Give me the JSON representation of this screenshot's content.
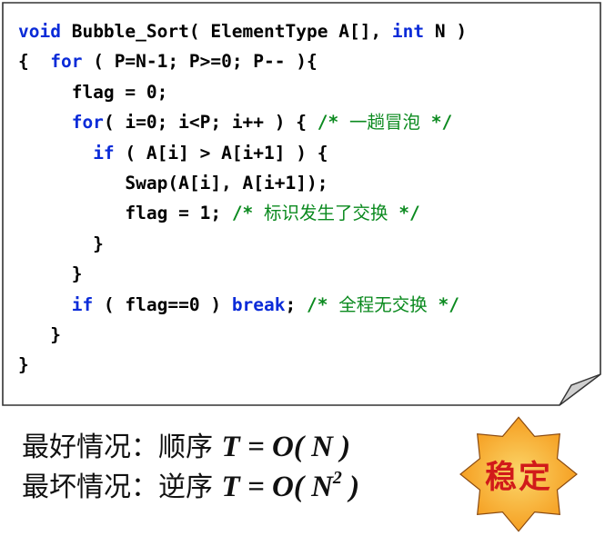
{
  "code": {
    "lines": [
      [
        {
          "t": "void",
          "c": "kw"
        },
        {
          "t": " Bubble_Sort( ElementType A[], ",
          "c": ""
        },
        {
          "t": "int",
          "c": "kw"
        },
        {
          "t": " N )",
          "c": ""
        }
      ],
      [
        {
          "t": "{  ",
          "c": ""
        },
        {
          "t": "for",
          "c": "kw"
        },
        {
          "t": " ( P=N-1; P>=0; P-- ){",
          "c": ""
        }
      ],
      [
        {
          "t": "     flag = 0;",
          "c": ""
        }
      ],
      [
        {
          "t": "     ",
          "c": ""
        },
        {
          "t": "for",
          "c": "kw"
        },
        {
          "t": "( i=0; i<P; i++ ) { ",
          "c": ""
        },
        {
          "t": "/* ",
          "c": "cm"
        },
        {
          "t": "一趟冒泡",
          "c": "cm cm-text"
        },
        {
          "t": " */",
          "c": "cm"
        }
      ],
      [
        {
          "t": "       ",
          "c": ""
        },
        {
          "t": "if",
          "c": "kw"
        },
        {
          "t": " ( A[i] > A[i+1] ) {",
          "c": ""
        }
      ],
      [
        {
          "t": "          Swap(A[i], A[i+1]);",
          "c": ""
        }
      ],
      [
        {
          "t": "          flag = 1; ",
          "c": ""
        },
        {
          "t": "/* ",
          "c": "cm"
        },
        {
          "t": "标识发生了交换",
          "c": "cm cm-text"
        },
        {
          "t": " */",
          "c": "cm"
        }
      ],
      [
        {
          "t": "       }",
          "c": ""
        }
      ],
      [
        {
          "t": "     }",
          "c": ""
        }
      ],
      [
        {
          "t": "     ",
          "c": ""
        },
        {
          "t": "if",
          "c": "kw"
        },
        {
          "t": " ( flag==0 ) ",
          "c": ""
        },
        {
          "t": "break",
          "c": "kw"
        },
        {
          "t": "; ",
          "c": ""
        },
        {
          "t": "/* ",
          "c": "cm"
        },
        {
          "t": "全程无交换",
          "c": "cm cm-text"
        },
        {
          "t": " */",
          "c": "cm"
        }
      ],
      [
        {
          "t": "   }",
          "c": ""
        }
      ],
      [
        {
          "t": "}",
          "c": ""
        }
      ]
    ]
  },
  "summary": {
    "best_label": "最好情况：顺序 ",
    "best_formula": "T = O( N )",
    "worst_label": "最坏情况：逆序 ",
    "worst_formula_pre": "T = O( N",
    "worst_exponent": "2",
    "worst_formula_post": " )"
  },
  "badge": {
    "label": "稳定"
  },
  "colors": {
    "keyword": "#0a2bd8",
    "comment": "#0b8a1f",
    "badge_text": "#d11a1a",
    "badge_fill_outer": "#f59a1b",
    "badge_fill_inner": "#fbd66a"
  }
}
